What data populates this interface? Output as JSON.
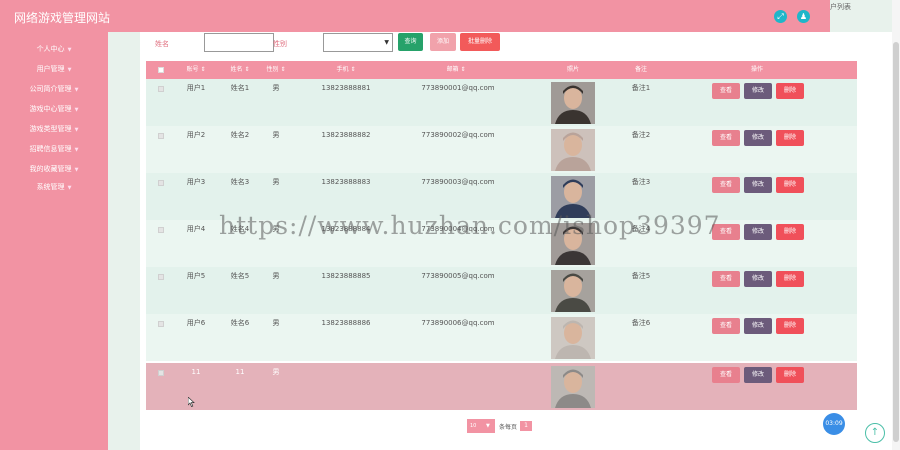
{
  "app": {
    "title": "网络游戏管理网站",
    "breadcrumb": "户列表"
  },
  "header_icons": [
    {
      "name": "fullscreen-icon",
      "glyph": "⤢"
    },
    {
      "name": "user-icon",
      "glyph": "♟"
    }
  ],
  "sidebar": {
    "items": [
      {
        "label": "个人中心"
      },
      {
        "label": "用户管理"
      },
      {
        "label": "公司简介管理"
      },
      {
        "label": "游戏中心管理"
      },
      {
        "label": "游戏类型管理"
      },
      {
        "label": "招聘信息管理"
      },
      {
        "label": "我的收藏管理"
      },
      {
        "label": "系统管理"
      }
    ]
  },
  "search": {
    "name_label": "姓名",
    "name_value": "",
    "gender_label": "性别",
    "gender_value": "",
    "query_label": "查询",
    "add_label": "添加",
    "batch_delete_label": "批量删除"
  },
  "table": {
    "headers": [
      "账号",
      "姓名",
      "性别",
      "手机",
      "邮箱",
      "照片",
      "备注",
      "操作"
    ],
    "rows": [
      {
        "account": "用户1",
        "name": "姓名1",
        "gender": "男",
        "phone": "13823888881",
        "email": "773890001@qq.com",
        "note": "备注1",
        "photo_tone": "#3a3430"
      },
      {
        "account": "用户2",
        "name": "姓名2",
        "gender": "男",
        "phone": "13823888882",
        "email": "773890002@qq.com",
        "note": "备注2",
        "photo_tone": "#b9a39a"
      },
      {
        "account": "用户3",
        "name": "姓名3",
        "gender": "男",
        "phone": "13823888883",
        "email": "773890003@qq.com",
        "note": "备注3",
        "photo_tone": "#2f3d5a"
      },
      {
        "account": "用户4",
        "name": "姓名4",
        "gender": "男",
        "phone": "13823888884",
        "email": "773890004@qq.com",
        "note": "备注4",
        "photo_tone": "#3b3636"
      },
      {
        "account": "用户5",
        "name": "姓名5",
        "gender": "男",
        "phone": "13823888885",
        "email": "773890005@qq.com",
        "note": "备注5",
        "photo_tone": "#4a4a44"
      },
      {
        "account": "用户6",
        "name": "姓名6",
        "gender": "男",
        "phone": "13823888886",
        "email": "773890006@qq.com",
        "note": "备注6",
        "photo_tone": "#bdb6b0"
      },
      {
        "account": "11",
        "name": "11",
        "gender": "男",
        "phone": "",
        "email": "",
        "note": "",
        "photo_tone": "#8d8a88"
      }
    ],
    "actions": {
      "view": "查看",
      "edit": "修改",
      "delete": "删除"
    }
  },
  "pager": {
    "page_size": "10",
    "per_page_label": "条每页",
    "current_page": "1"
  },
  "float_time": "03:09",
  "watermark": "https://www.huzhan.com/ishop39397",
  "colors": {
    "primary_pink": "#f293a3",
    "row_odd": "#e3f2ec",
    "row_even": "#ebf6f1",
    "row_highlight": "#e4b2ba",
    "query_green": "#26a26a",
    "add_pink": "#f1a2ab",
    "batch_red": "#f25a5a",
    "view_pink": "#e8808e",
    "edit_purple": "#6c5b7b",
    "delete_red": "#f0505a"
  }
}
